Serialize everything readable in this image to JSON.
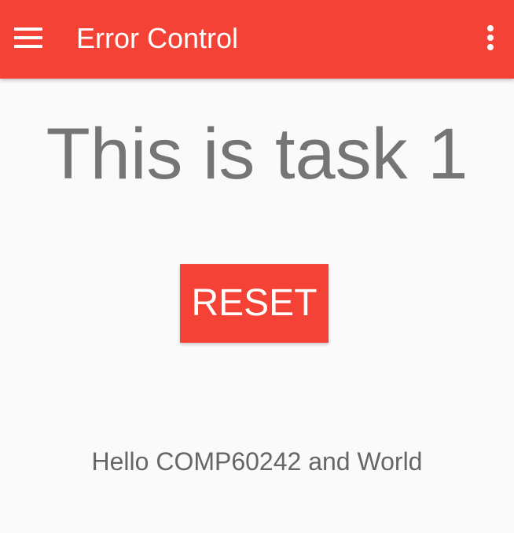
{
  "app_bar": {
    "title": "Error Control",
    "menu_icon": "menu-icon",
    "overflow_icon": "overflow-menu-icon",
    "color": "#f44336"
  },
  "main": {
    "heading": "This is task 1",
    "reset_label": "RESET",
    "footer_text": "Hello COMP60242 and World"
  },
  "colors": {
    "accent": "#f44336",
    "background": "#fafafa",
    "heading_text": "#757575"
  }
}
